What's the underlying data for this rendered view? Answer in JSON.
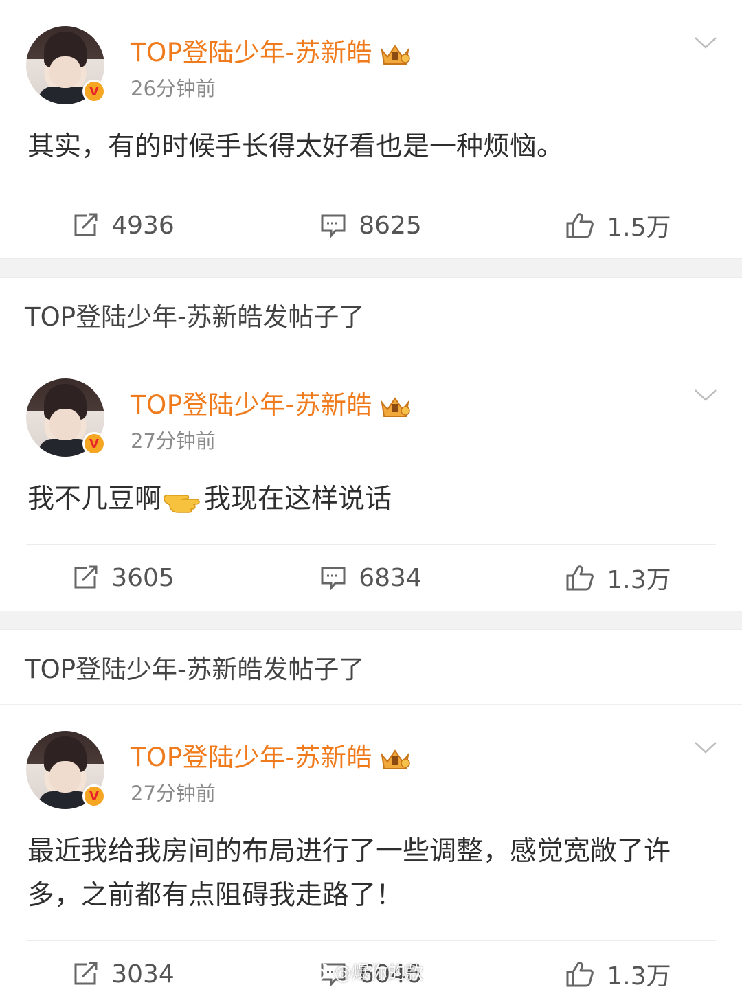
{
  "posts": [
    {
      "username": "TOP登陆少年-苏新皓",
      "timestamp": "26分钟前",
      "text": "其实，有的时候手长得太好看也是一种烦恼。",
      "reposts": "4936",
      "comments": "8625",
      "likes": "1.5万"
    },
    {
      "repost_header": "TOP登陆少年-苏新皓发帖子了",
      "username": "TOP登陆少年-苏新皓",
      "timestamp": "27分钟前",
      "text_before_emoji": "我不几豆啊",
      "text_after_emoji": "我现在这样说话",
      "reposts": "3605",
      "comments": "6834",
      "likes": "1.3万"
    },
    {
      "repost_header": "TOP登陆少年-苏新皓发帖子了",
      "username": "TOP登陆少年-苏新皓",
      "timestamp": "27分钟前",
      "text": "最近我给我房间的布局进行了一些调整，感觉宽敞了许多，之前都有点阻碍我走路了！",
      "reposts": "3034",
      "comments": "6046",
      "likes": "1.3万"
    }
  ],
  "watermark": "@爆你的款",
  "colors": {
    "username": "#f07b1d",
    "verified_badge": "#f5a623",
    "verified_v": "#e8242b",
    "separator": "#f2f2f2"
  },
  "icons": {
    "repost": "repost-icon",
    "comment": "comment-icon",
    "like": "thumbs-up-icon",
    "menu": "chevron-down-icon",
    "crown": "crown-icon",
    "emoji": "pointing-hand-emoji"
  }
}
